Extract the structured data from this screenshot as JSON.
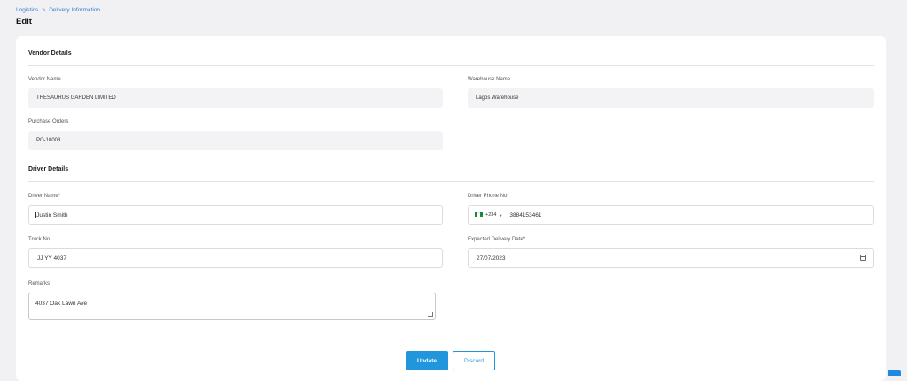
{
  "breadcrumb": {
    "root": "Logistics",
    "separator": "»",
    "current": "Delivery Information"
  },
  "page_title": "Edit",
  "vendor_section": {
    "title": "Vendor Details",
    "vendor_name_label": "Vendor Name",
    "vendor_name_value": "THESAURUS GARDEN LIMITED",
    "warehouse_label": "Warehouse Name",
    "warehouse_value": "Lagos Warehouse",
    "po_label": "Purchase Orders",
    "po_value": "PO-10008"
  },
  "driver_section": {
    "title": "Driver Details",
    "driver_name_label": "Driver Name*",
    "driver_name_value": "Justin Smith",
    "driver_phone_label": "Driver Phone No*",
    "phone_code": "+234",
    "phone_value": "3884153461",
    "truck_label": "Truck No",
    "truck_value": "JJ YY 4037",
    "delivery_date_label": "Expected Delivery Date*",
    "delivery_date_value": "27/07/2023",
    "remarks_label": "Remarks",
    "remarks_value": "4037 Oak Lawn Ave"
  },
  "actions": {
    "update": "Update",
    "discard": "Discard"
  },
  "colors": {
    "accent": "#2196dc",
    "link": "#2a7fd4",
    "background": "#f1f1f3"
  }
}
